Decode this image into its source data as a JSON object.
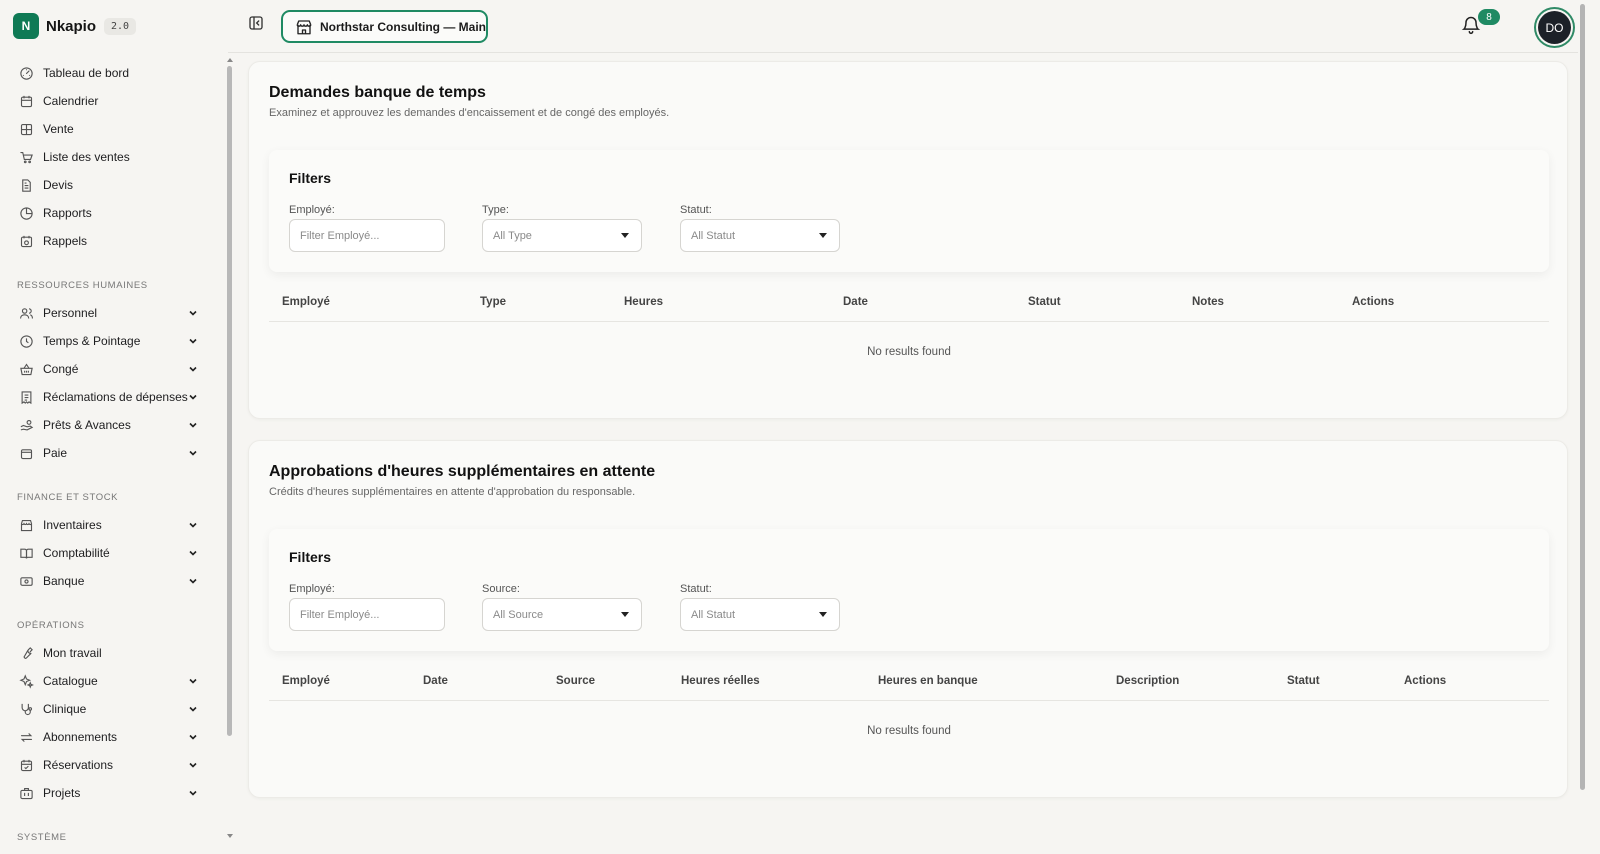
{
  "brand": {
    "logo_letter": "N",
    "name": "Nkapio",
    "version": "2.0"
  },
  "sidebar": {
    "main_items": [
      {
        "label": "Tableau de bord",
        "icon": "gauge-icon"
      },
      {
        "label": "Calendrier",
        "icon": "calendar-icon"
      },
      {
        "label": "Vente",
        "icon": "grid-icon"
      },
      {
        "label": "Liste des ventes",
        "icon": "cart-icon"
      },
      {
        "label": "Devis",
        "icon": "document-icon"
      },
      {
        "label": "Rapports",
        "icon": "pie-chart-icon"
      },
      {
        "label": "Rappels",
        "icon": "calendar-clock-icon"
      }
    ],
    "sections": [
      {
        "title": "RESSOURCES HUMAINES",
        "items": [
          {
            "label": "Personnel",
            "icon": "users-icon"
          },
          {
            "label": "Temps & Pointage",
            "icon": "clock-icon"
          },
          {
            "label": "Congé",
            "icon": "basket-icon"
          },
          {
            "label": "Réclamations de dépenses",
            "icon": "receipt-icon"
          },
          {
            "label": "Prêts & Avances",
            "icon": "hand-coins-icon"
          },
          {
            "label": "Paie",
            "icon": "wallet-icon"
          }
        ]
      },
      {
        "title": "FINANCE ET STOCK",
        "items": [
          {
            "label": "Inventaires",
            "icon": "store-icon"
          },
          {
            "label": "Comptabilité",
            "icon": "book-open-icon"
          },
          {
            "label": "Banque",
            "icon": "banknote-icon"
          }
        ]
      },
      {
        "title": "OPÉRATIONS",
        "items": [
          {
            "label": "Mon travail",
            "icon": "wrench-icon"
          },
          {
            "label": "Catalogue",
            "icon": "sparkles-icon"
          },
          {
            "label": "Clinique",
            "icon": "stethoscope-icon"
          },
          {
            "label": "Abonnements",
            "icon": "repeat-icon"
          },
          {
            "label": "Réservations",
            "icon": "calendar-check-icon"
          },
          {
            "label": "Projets",
            "icon": "briefcase-icon"
          }
        ]
      }
    ],
    "system_title": "SYSTÈME"
  },
  "header": {
    "store_name": "Northstar Consulting — Main",
    "notification_count": "8",
    "avatar_initials": "DO"
  },
  "colors": {
    "accent": "#1f8a63",
    "background": "#f6f5f2",
    "card": "#fafaf8",
    "avatar": "#1c2128"
  },
  "time_bank": {
    "title": "Demandes banque de temps",
    "subtitle": "Examinez et approuvez les demandes d'encaissement et de congé des employés.",
    "filters": {
      "title": "Filters",
      "employee_label": "Employé:",
      "employee_placeholder": "Filter Employé...",
      "second_label": "Type:",
      "second_value": "All Type",
      "status_label": "Statut:",
      "status_value": "All Statut"
    },
    "columns": [
      "Employé",
      "Type",
      "Heures",
      "Date",
      "Statut",
      "Notes",
      "Actions"
    ],
    "empty_text": "No results found"
  },
  "overtime": {
    "title": "Approbations d'heures supplémentaires en attente",
    "subtitle": "Crédits d'heures supplémentaires en attente d'approbation du responsable.",
    "filters": {
      "title": "Filters",
      "employee_label": "Employé:",
      "employee_placeholder": "Filter Employé...",
      "second_label": "Source:",
      "second_value": "All Source",
      "status_label": "Statut:",
      "status_value": "All Statut"
    },
    "columns": [
      "Employé",
      "Date",
      "Source",
      "Heures réelles",
      "Heures en banque",
      "Description",
      "Statut",
      "Actions"
    ],
    "empty_text": "No results found"
  }
}
